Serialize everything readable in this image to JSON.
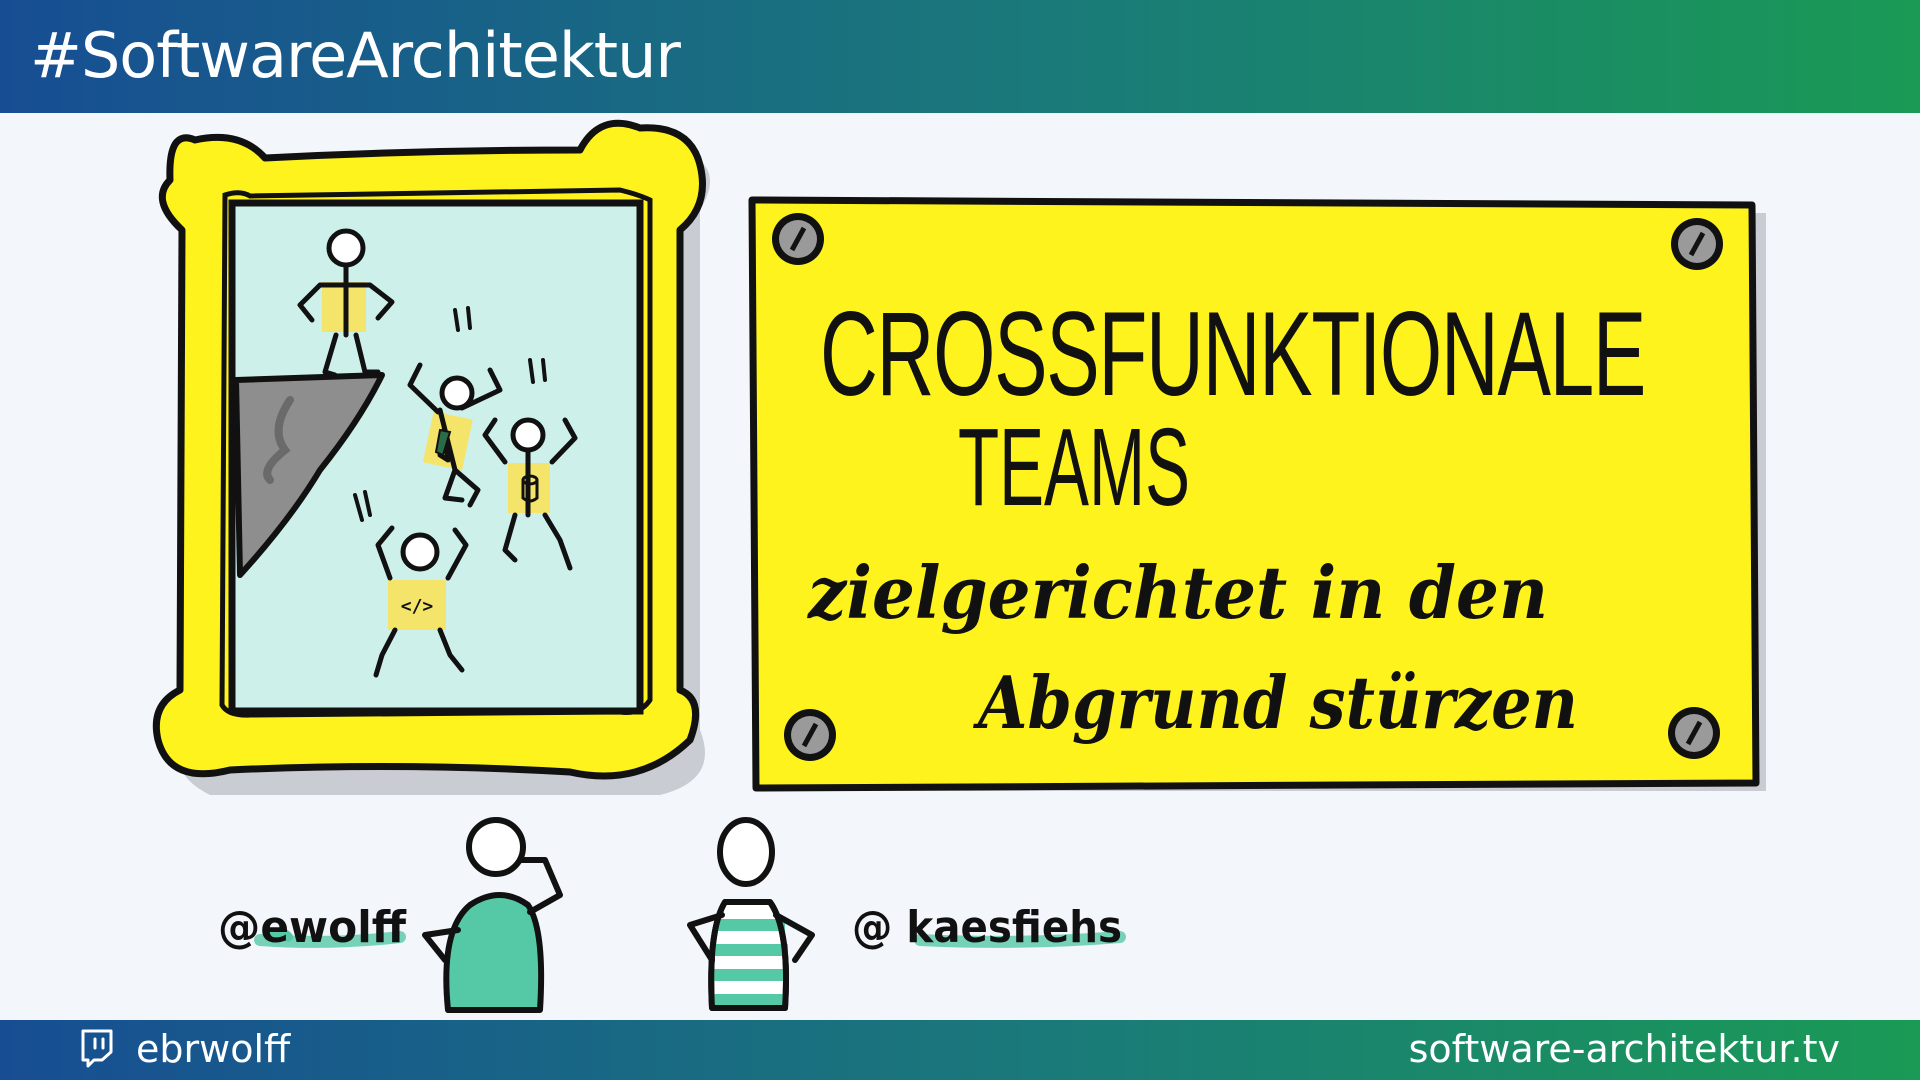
{
  "header": {
    "title": "#SoftwareArchitektur"
  },
  "sign": {
    "line1": "CROSSFUNKTIONALE",
    "line2": "TEAMS",
    "line3": "zielgerichtet in den",
    "line4": "Abgrund stürzen"
  },
  "people": {
    "left_handle": "@ewolff",
    "right_handle": "@ kaesfiehs"
  },
  "footer": {
    "channel_icon": "twitch-icon",
    "channel": "ebrwolff",
    "website": "software-architektur.tv"
  },
  "colors": {
    "header_gradient_start": "#174e93",
    "header_gradient_end": "#1a9a55",
    "sign_yellow": "#fff31e",
    "frame_yellow": "#fff31e",
    "painting_bg": "#cdf1ea",
    "teal": "#55c9a6"
  }
}
